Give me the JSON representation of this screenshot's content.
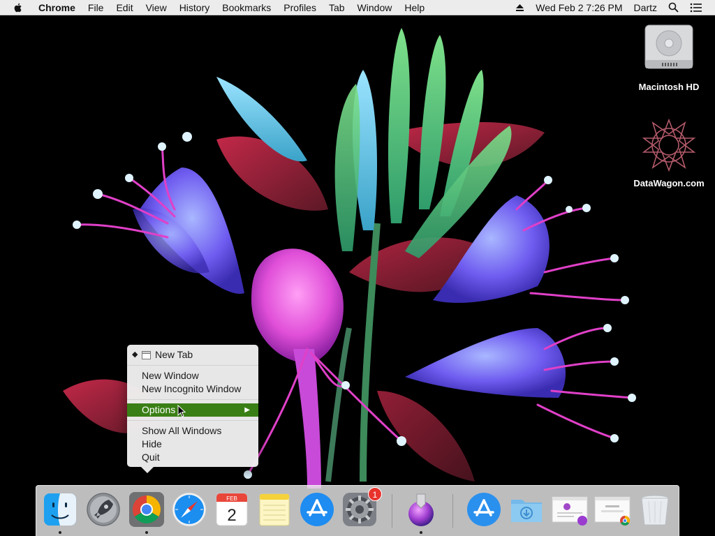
{
  "menubar": {
    "app_name": "Chrome",
    "items": [
      "File",
      "Edit",
      "View",
      "History",
      "Bookmarks",
      "Profiles",
      "Tab",
      "Window",
      "Help"
    ],
    "clock": "Wed Feb 2  7:26 PM",
    "user": "Dartz",
    "icons": [
      "apple-icon",
      "eject-icon",
      "spotlight-search-icon",
      "notification-center-icon"
    ]
  },
  "desktop": {
    "icons": [
      {
        "label": "Macintosh HD",
        "icon": "hard-drive-icon"
      },
      {
        "label": "DataWagon.com",
        "icon": "geometric-star-icon"
      }
    ]
  },
  "context_menu": {
    "items": [
      {
        "label": "New Tab",
        "checked": true,
        "icon": "window-icon"
      },
      {
        "label": "New Window"
      },
      {
        "label": "New Incognito Window"
      },
      {
        "label": "Options",
        "selected": true,
        "submenu": true
      },
      {
        "label": "Show All Windows"
      },
      {
        "label": "Hide"
      },
      {
        "label": "Quit"
      }
    ],
    "selected_color": "#3a7f15"
  },
  "dock": {
    "items": [
      {
        "app": "Finder",
        "icon": "finder-icon",
        "running": true
      },
      {
        "app": "Launchpad",
        "icon": "launchpad-rocket-icon",
        "running": false
      },
      {
        "app": "Google Chrome",
        "icon": "chrome-icon",
        "running": true
      },
      {
        "app": "Safari",
        "icon": "safari-compass-icon",
        "running": false
      },
      {
        "app": "Calendar",
        "icon": "calendar-icon",
        "running": false,
        "month": "FEB",
        "day": "2"
      },
      {
        "app": "Notes",
        "icon": "notes-icon",
        "running": false
      },
      {
        "app": "App Store",
        "icon": "app-store-icon",
        "running": false
      },
      {
        "app": "System Preferences",
        "icon": "gear-icon",
        "running": false,
        "badge": "1"
      },
      {
        "app": "Installer",
        "icon": "installer-disk-icon",
        "running": true
      },
      {
        "app": "Applications",
        "icon": "applications-folder-icon",
        "running": false
      },
      {
        "app": "Downloads",
        "icon": "downloads-folder-icon",
        "running": false
      },
      {
        "app": "Window 1",
        "icon": "window-thumbnail-icon",
        "running": false
      },
      {
        "app": "Window 2",
        "icon": "chrome-window-thumbnail-icon",
        "running": false
      },
      {
        "app": "Trash",
        "icon": "trash-icon",
        "running": false
      }
    ]
  }
}
